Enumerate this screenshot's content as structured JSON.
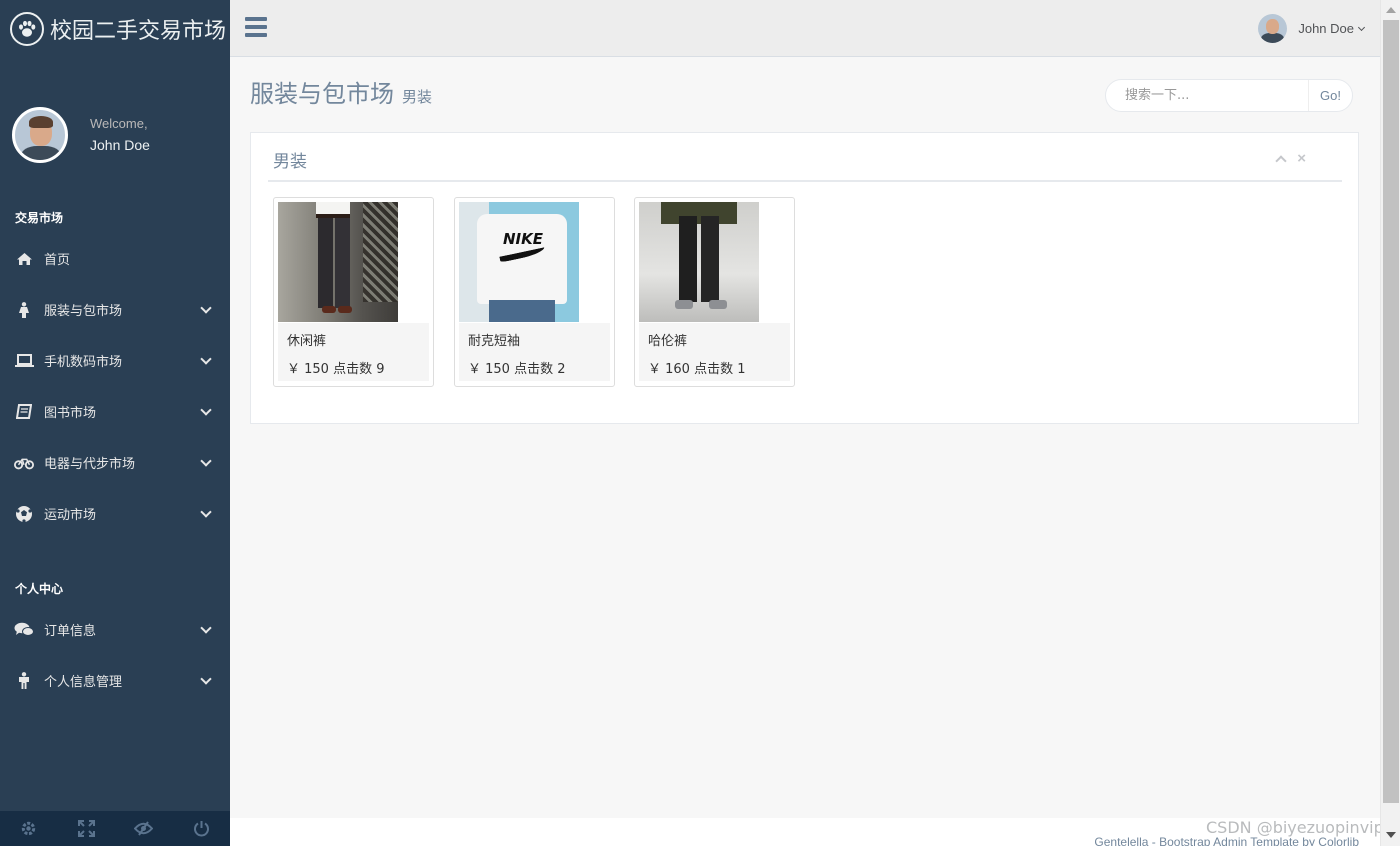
{
  "brand": {
    "title": "校园二手交易市场",
    "icon": "paw-icon"
  },
  "profile": {
    "welcome": "Welcome,",
    "name": "John Doe"
  },
  "sidebar": {
    "section1": "交易市场",
    "items1": [
      {
        "label": "首页",
        "icon": "home-icon"
      },
      {
        "label": "服装与包市场",
        "icon": "female-icon"
      },
      {
        "label": "手机数码市场",
        "icon": "laptop-icon"
      },
      {
        "label": "图书市场",
        "icon": "book-icon"
      },
      {
        "label": "电器与代步市场",
        "icon": "bicycle-icon"
      },
      {
        "label": "运动市场",
        "icon": "soccer-ball-icon"
      }
    ],
    "section2": "个人中心",
    "items2": [
      {
        "label": "订单信息",
        "icon": "comments-icon"
      },
      {
        "label": "个人信息管理",
        "icon": "male-icon"
      }
    ],
    "footer_icons": [
      "settings-icon",
      "fullscreen-icon",
      "lock-icon",
      "logout-icon"
    ]
  },
  "topnav": {
    "user_name": "John Doe"
  },
  "page": {
    "title": "服装与包市场",
    "subtitle": "男装"
  },
  "search": {
    "placeholder": "搜索一下...",
    "button": "Go!"
  },
  "panel": {
    "title": "男装",
    "products": [
      {
        "name": "休闲裤",
        "meta": "￥ 150 点击数 9"
      },
      {
        "name": "耐克短袖",
        "meta": "￥ 150 点击数 2"
      },
      {
        "name": "哈伦裤",
        "meta": "￥ 160 点击数 1"
      }
    ]
  },
  "footer": {
    "text": "Gentelella - Bootstrap Admin Template by Colorlib"
  },
  "watermark": "CSDN @biyezuopinvip",
  "colors": {
    "sidebar": "#2A3F54",
    "sidebar_footer": "#172D44",
    "text": "#73879C",
    "background": "#F7F7F7"
  }
}
